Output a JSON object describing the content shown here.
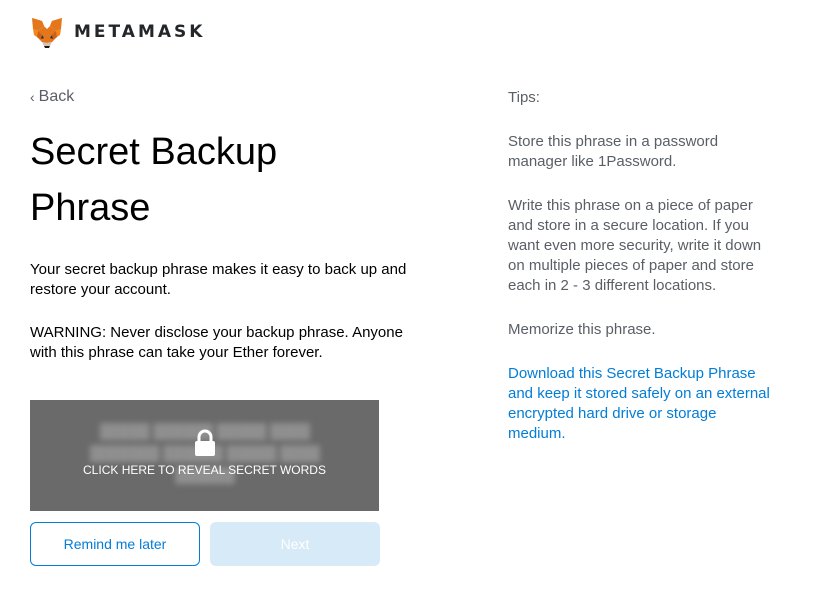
{
  "header": {
    "brand": "METAMASK",
    "logo_icon": "metamask-fox-icon"
  },
  "nav": {
    "back_label": "Back"
  },
  "main": {
    "title": "Secret Backup Phrase",
    "description": "Your secret backup phrase makes it easy to back up and restore your account.",
    "warning": "WARNING: Never disclose your backup phrase. Anyone with this phrase can take your Ether forever.",
    "reveal": {
      "label": "CLICK HERE TO REVEAL SECRET WORDS",
      "icon": "lock-icon",
      "background": "#6a6a6a"
    }
  },
  "buttons": {
    "remind_label": "Remind me later",
    "next_label": "Next"
  },
  "tips": {
    "title": "Tips:",
    "items": [
      "Store this phrase in a password manager like 1Password.",
      "Write this phrase on a piece of paper and store in a secure location. If you want even more security, write it down on multiple pieces of paper and store each in 2 - 3 different locations.",
      "Memorize this phrase."
    ],
    "download_link": "Download this Secret Backup Phrase and keep it stored safely on an external encrypted hard drive or storage medium."
  },
  "colors": {
    "accent": "#037dd6",
    "next_disabled_bg": "#d6eaf8"
  }
}
